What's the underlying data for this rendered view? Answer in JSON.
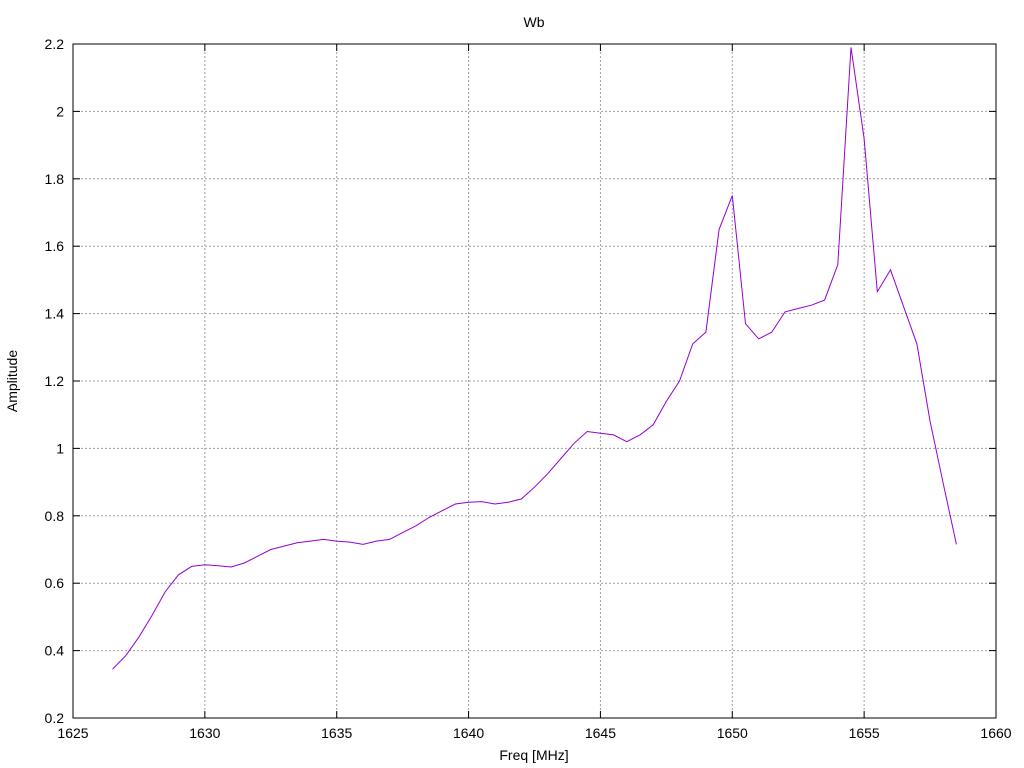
{
  "chart_data": {
    "type": "line",
    "title": "Wb",
    "xlabel": "Freq [MHz]",
    "ylabel": "Amplitude",
    "xlim": [
      1625,
      1660
    ],
    "ylim": [
      0.2,
      2.2
    ],
    "xticks": [
      1625,
      1630,
      1635,
      1640,
      1645,
      1650,
      1655,
      1660
    ],
    "yticks": [
      0.2,
      0.4,
      0.6,
      0.8,
      1,
      1.2,
      1.4,
      1.6,
      1.8,
      2,
      2.2
    ],
    "xtick_labels": [
      "1625",
      "1630",
      "1635",
      "1640",
      "1645",
      "1650",
      "1655",
      "1660"
    ],
    "ytick_labels": [
      "0.2",
      "0.4",
      "0.6",
      "0.8",
      "1",
      "1.2",
      "1.4",
      "1.6",
      "1.8",
      "2",
      "2.2"
    ],
    "grid": true,
    "series": [
      {
        "color": "#9400d3",
        "x": [
          1626.5,
          1627.0,
          1627.5,
          1628.0,
          1628.5,
          1629.0,
          1629.5,
          1630.0,
          1630.5,
          1631.0,
          1631.5,
          1632.0,
          1632.5,
          1633.0,
          1633.5,
          1634.0,
          1634.5,
          1635.0,
          1635.5,
          1636.0,
          1636.5,
          1637.0,
          1637.5,
          1638.0,
          1638.5,
          1639.0,
          1639.5,
          1640.0,
          1640.5,
          1641.0,
          1641.5,
          1642.0,
          1642.5,
          1643.0,
          1643.5,
          1644.0,
          1644.5,
          1645.0,
          1645.5,
          1646.0,
          1646.5,
          1647.0,
          1647.5,
          1648.0,
          1648.5,
          1649.0,
          1649.5,
          1650.0,
          1650.5,
          1651.0,
          1651.5,
          1652.0,
          1652.5,
          1653.0,
          1653.5,
          1654.0,
          1654.5,
          1655.0,
          1655.5,
          1656.0,
          1656.5,
          1657.0,
          1657.5,
          1658.0,
          1658.5
        ],
        "y": [
          0.345,
          0.385,
          0.44,
          0.505,
          0.575,
          0.625,
          0.65,
          0.655,
          0.652,
          0.648,
          0.66,
          0.68,
          0.7,
          0.71,
          0.72,
          0.725,
          0.73,
          0.725,
          0.722,
          0.715,
          0.725,
          0.73,
          0.75,
          0.77,
          0.795,
          0.815,
          0.835,
          0.84,
          0.842,
          0.835,
          0.84,
          0.85,
          0.885,
          0.925,
          0.97,
          1.015,
          1.05,
          1.045,
          1.04,
          1.02,
          1.04,
          1.07,
          1.14,
          1.2,
          1.31,
          1.345,
          1.65,
          1.75,
          1.37,
          1.325,
          1.345,
          1.405,
          1.415,
          1.425,
          1.44,
          1.545,
          2.19,
          1.92,
          1.465,
          1.53,
          1.42,
          1.31,
          1.08,
          0.895,
          0.715
        ]
      }
    ]
  }
}
